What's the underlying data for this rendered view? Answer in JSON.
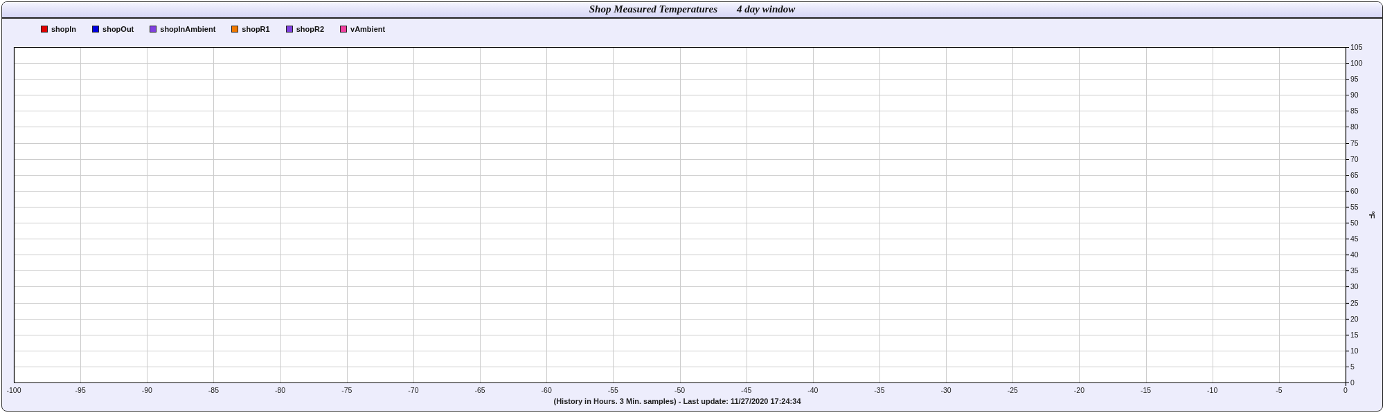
{
  "window": {
    "title": "Shop Measured Temperatures",
    "subtitle": "4 day window"
  },
  "chart": {
    "chart_data": {
      "type": "line",
      "xlabel": "(History in Hours. 3 Min. samples) - Last update: 11/27/2020 17:24:34",
      "ylabel": "°F",
      "series": [
        {
          "name": "shopIn",
          "color": "#e00000",
          "values": [
            null,
            null,
            null,
            null,
            null,
            null,
            null,
            null,
            null,
            null,
            null,
            null,
            null,
            null,
            null,
            null,
            null,
            null,
            null,
            null,
            null
          ]
        },
        {
          "name": "shopOut",
          "color": "#0000e0",
          "values": [
            null,
            null,
            null,
            null,
            null,
            null,
            null,
            null,
            null,
            null,
            null,
            null,
            null,
            null,
            null,
            null,
            null,
            null,
            null,
            null,
            null
          ]
        },
        {
          "name": "shopInAmbient",
          "color": "#8040e0",
          "values": [
            null,
            null,
            null,
            null,
            null,
            null,
            null,
            null,
            null,
            null,
            null,
            null,
            null,
            null,
            null,
            null,
            null,
            null,
            null,
            null,
            null
          ]
        },
        {
          "name": "shopR1",
          "color": "#f07800",
          "values": [
            null,
            null,
            null,
            null,
            null,
            null,
            null,
            null,
            null,
            null,
            null,
            null,
            null,
            null,
            null,
            null,
            null,
            null,
            null,
            null,
            null
          ]
        },
        {
          "name": "shopR2",
          "color": "#8040e0",
          "values": [
            null,
            null,
            null,
            null,
            null,
            null,
            null,
            null,
            null,
            null,
            null,
            null,
            null,
            null,
            null,
            null,
            null,
            null,
            null,
            null,
            null
          ]
        },
        {
          "name": "vAmbient",
          "color": "#f040a0",
          "values": [
            null,
            null,
            null,
            null,
            null,
            null,
            null,
            null,
            null,
            null,
            null,
            null,
            null,
            null,
            null,
            null,
            null,
            null,
            null,
            null,
            null
          ]
        }
      ],
      "categories": [
        "-100",
        "-95",
        "-90",
        "-85",
        "-80",
        "-75",
        "-70",
        "-65",
        "-60",
        "-55",
        "-50",
        "-45",
        "-40",
        "-35",
        "-30",
        "-25",
        "-20",
        "-15",
        "-10",
        "-5",
        "0"
      ],
      "grid": true,
      "ylim": [
        0,
        105
      ],
      "yticks": [
        0,
        5,
        10,
        15,
        20,
        25,
        30,
        35,
        40,
        45,
        50,
        55,
        60,
        65,
        70,
        75,
        80,
        85,
        90,
        95,
        100,
        105
      ]
    }
  }
}
